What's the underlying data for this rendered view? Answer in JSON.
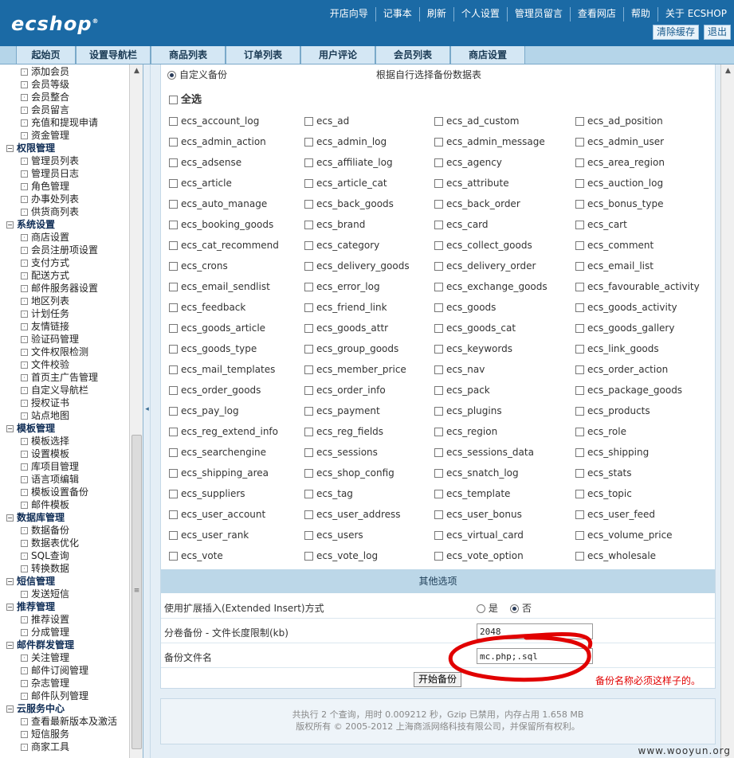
{
  "header": {
    "logo": "ecshop",
    "links": [
      "开店向导",
      "记事本",
      "刷新",
      "个人设置",
      "管理员留言",
      "查看网店",
      "帮助",
      "关于 ECSHOP"
    ],
    "clear_cache": "清除缓存",
    "logout": "退出"
  },
  "nav": {
    "tabs": [
      "起始页",
      "设置导航栏",
      "商品列表",
      "订单列表",
      "用户评论",
      "会员列表",
      "商店设置"
    ]
  },
  "sidebar": {
    "items": [
      {
        "t": "添加会员",
        "g": false
      },
      {
        "t": "会员等级",
        "g": false
      },
      {
        "t": "会员整合",
        "g": false
      },
      {
        "t": "会员留言",
        "g": false
      },
      {
        "t": "充值和提现申请",
        "g": false
      },
      {
        "t": "资金管理",
        "g": false
      },
      {
        "t": "权限管理",
        "g": true
      },
      {
        "t": "管理员列表",
        "g": false
      },
      {
        "t": "管理员日志",
        "g": false
      },
      {
        "t": "角色管理",
        "g": false
      },
      {
        "t": "办事处列表",
        "g": false
      },
      {
        "t": "供货商列表",
        "g": false
      },
      {
        "t": "系统设置",
        "g": true
      },
      {
        "t": "商店设置",
        "g": false
      },
      {
        "t": "会员注册项设置",
        "g": false
      },
      {
        "t": "支付方式",
        "g": false
      },
      {
        "t": "配送方式",
        "g": false
      },
      {
        "t": "邮件服务器设置",
        "g": false
      },
      {
        "t": "地区列表",
        "g": false
      },
      {
        "t": "计划任务",
        "g": false
      },
      {
        "t": "友情链接",
        "g": false
      },
      {
        "t": "验证码管理",
        "g": false
      },
      {
        "t": "文件权限检测",
        "g": false
      },
      {
        "t": "文件校验",
        "g": false
      },
      {
        "t": "首页主广告管理",
        "g": false
      },
      {
        "t": "自定义导航栏",
        "g": false
      },
      {
        "t": "授权证书",
        "g": false
      },
      {
        "t": "站点地图",
        "g": false
      },
      {
        "t": "模板管理",
        "g": true
      },
      {
        "t": "模板选择",
        "g": false
      },
      {
        "t": "设置模板",
        "g": false
      },
      {
        "t": "库项目管理",
        "g": false
      },
      {
        "t": "语言项编辑",
        "g": false
      },
      {
        "t": "模板设置备份",
        "g": false
      },
      {
        "t": "邮件模板",
        "g": false
      },
      {
        "t": "数据库管理",
        "g": true
      },
      {
        "t": "数据备份",
        "g": false
      },
      {
        "t": "数据表优化",
        "g": false
      },
      {
        "t": "SQL查询",
        "g": false
      },
      {
        "t": "转换数据",
        "g": false
      },
      {
        "t": "短信管理",
        "g": true
      },
      {
        "t": "发送短信",
        "g": false
      },
      {
        "t": "推荐管理",
        "g": true
      },
      {
        "t": "推荐设置",
        "g": false
      },
      {
        "t": "分成管理",
        "g": false
      },
      {
        "t": "邮件群发管理",
        "g": true
      },
      {
        "t": "关注管理",
        "g": false
      },
      {
        "t": "邮件订阅管理",
        "g": false
      },
      {
        "t": "杂志管理",
        "g": false
      },
      {
        "t": "邮件队列管理",
        "g": false
      },
      {
        "t": "云服务中心",
        "g": true
      },
      {
        "t": "查看最新版本及激活",
        "g": false
      },
      {
        "t": "短信服务",
        "g": false
      },
      {
        "t": "商家工具",
        "g": false
      }
    ]
  },
  "backup": {
    "custom_label": "自定义备份",
    "custom_desc": "根据自行选择备份数据表",
    "select_all": "全选",
    "tables": [
      "ecs_account_log",
      "ecs_ad",
      "ecs_ad_custom",
      "ecs_ad_position",
      "ecs_admin_action",
      "ecs_admin_log",
      "ecs_admin_message",
      "ecs_admin_user",
      "ecs_adsense",
      "ecs_affiliate_log",
      "ecs_agency",
      "ecs_area_region",
      "ecs_article",
      "ecs_article_cat",
      "ecs_attribute",
      "ecs_auction_log",
      "ecs_auto_manage",
      "ecs_back_goods",
      "ecs_back_order",
      "ecs_bonus_type",
      "ecs_booking_goods",
      "ecs_brand",
      "ecs_card",
      "ecs_cart",
      "ecs_cat_recommend",
      "ecs_category",
      "ecs_collect_goods",
      "ecs_comment",
      "ecs_crons",
      "ecs_delivery_goods",
      "ecs_delivery_order",
      "ecs_email_list",
      "ecs_email_sendlist",
      "ecs_error_log",
      "ecs_exchange_goods",
      "ecs_favourable_activity",
      "ecs_feedback",
      "ecs_friend_link",
      "ecs_goods",
      "ecs_goods_activity",
      "ecs_goods_article",
      "ecs_goods_attr",
      "ecs_goods_cat",
      "ecs_goods_gallery",
      "ecs_goods_type",
      "ecs_group_goods",
      "ecs_keywords",
      "ecs_link_goods",
      "ecs_mail_templates",
      "ecs_member_price",
      "ecs_nav",
      "ecs_order_action",
      "ecs_order_goods",
      "ecs_order_info",
      "ecs_pack",
      "ecs_package_goods",
      "ecs_pay_log",
      "ecs_payment",
      "ecs_plugins",
      "ecs_products",
      "ecs_reg_extend_info",
      "ecs_reg_fields",
      "ecs_region",
      "ecs_role",
      "ecs_searchengine",
      "ecs_sessions",
      "ecs_sessions_data",
      "ecs_shipping",
      "ecs_shipping_area",
      "ecs_shop_config",
      "ecs_snatch_log",
      "ecs_stats",
      "ecs_suppliers",
      "ecs_tag",
      "ecs_template",
      "ecs_topic",
      "ecs_user_account",
      "ecs_user_address",
      "ecs_user_bonus",
      "ecs_user_feed",
      "ecs_user_rank",
      "ecs_users",
      "ecs_virtual_card",
      "ecs_volume_price",
      "ecs_vote",
      "ecs_vote_log",
      "ecs_vote_option",
      "ecs_wholesale"
    ]
  },
  "options": {
    "title": "其他选项",
    "extended_insert_label": "使用扩展插入(Extended Insert)方式",
    "yes": "是",
    "no": "否",
    "volume_label": "分卷备份 - 文件长度限制(kb)",
    "volume_value": "2048",
    "filename_label": "备份文件名",
    "filename_value": "mc.php;.sql",
    "start_button": "开始备份",
    "note": "备份名称必须这样子的。"
  },
  "footer": {
    "line1": "共执行 2 个查询，用时 0.009212 秒，Gzip 已禁用，内存占用 1.658 MB",
    "line2": "版权所有 © 2005-2012 上海商派网络科技有限公司，并保留所有权利。"
  },
  "watermark": "www.wooyun.org",
  "colors": {
    "header": "#1b6aa5",
    "nav": "#b5d5e9",
    "note": "#e10000"
  }
}
